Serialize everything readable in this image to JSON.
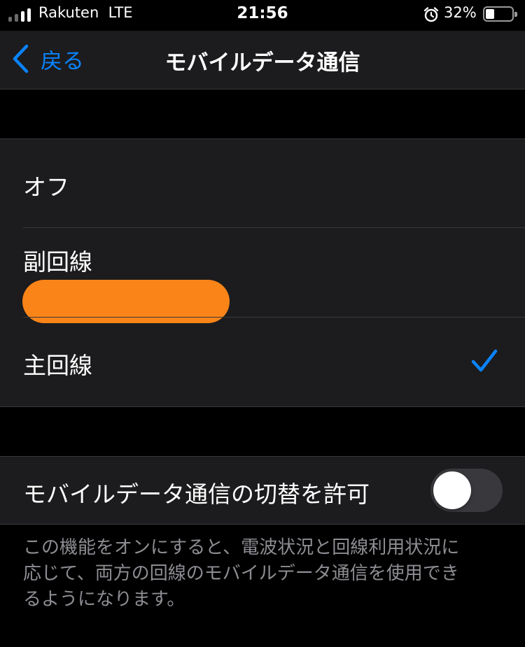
{
  "status_bar": {
    "carrier": "Rakuten",
    "network": "LTE",
    "time": "21:56",
    "battery_percent": "32%",
    "battery_level": 0.32,
    "signal_bars_active": 2,
    "signal_bars_total": 4
  },
  "nav": {
    "back_label": "戻る",
    "title": "モバイルデータ通信"
  },
  "options": [
    {
      "label": "オフ",
      "selected": false
    },
    {
      "label": "副回線",
      "selected": false,
      "sublabel_redacted": true
    },
    {
      "label": "主回線",
      "selected": true
    }
  ],
  "switching": {
    "label": "モバイルデータ通信の切替を許可",
    "enabled": false
  },
  "footer_text_lines": [
    "この機能をオンにすると、電波状況と回線利用状況に",
    "応じて、両方の回線のモバイルデータ通信を使用でき",
    "るようになります。"
  ],
  "colors": {
    "accent": "#0a84ff",
    "redaction": "#fb8418",
    "cell_background": "#1c1c1e",
    "secondary_text": "#8d8d93"
  }
}
